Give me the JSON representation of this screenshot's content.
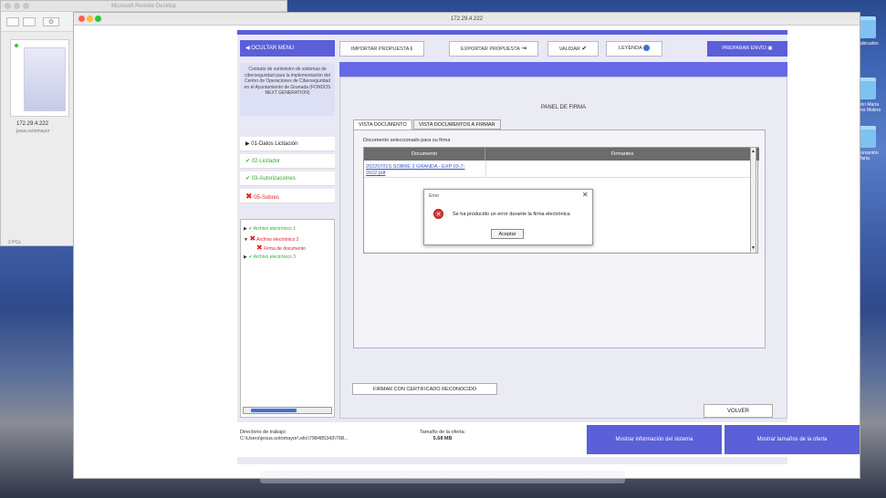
{
  "remote_desktop": {
    "title": "Microsoft Remote Desktop",
    "thumbnail_title": "172.29.4.222",
    "thumbnail_subtitle": "jesus.sotomayor",
    "pcs_count": "2 PCs"
  },
  "desktop_icons": [
    {
      "label": "ms reubicados"
    },
    {
      "label": "omunión María otomayor Molero"
    },
    {
      "label": "ium Comunión María"
    }
  ],
  "window": {
    "title": "172.29.4.222"
  },
  "side_menu": {
    "hide_label": "OCULTAR MENU",
    "contract_text": "Contrato de suministro de sistemas de ciberseguridad para la implementación del Centro de Operaciones de Ciberseguridad en el Ayuntamiento de Granada (FONDOS NEXT GENERATION)",
    "items": [
      {
        "label": "01-Datos Licitación",
        "status": "arrow",
        "color": "#222222"
      },
      {
        "label": "02-Licitador",
        "status": "check",
        "color": "#3aa83a"
      },
      {
        "label": "03-Autorizaciones",
        "status": "check",
        "color": "#3aa83a"
      },
      {
        "label": "05-Sobres",
        "status": "cross",
        "color": "#e02020"
      }
    ],
    "tree": [
      {
        "label": "Archivo electrónico 1",
        "status": "check",
        "color": "#3aa83a",
        "indent": 0
      },
      {
        "label": "Archivo electrónico 2",
        "status": "cross",
        "color": "#e02020",
        "indent": 0
      },
      {
        "label": "Firma de documento",
        "status": "cross",
        "color": "#e02020",
        "indent": 1
      },
      {
        "label": "Archivo electrónico 3",
        "status": "check",
        "color": "#3aa83a",
        "indent": 0
      }
    ]
  },
  "toolbar": {
    "import_label": "IMPORTAR PROPUESTA",
    "export_label": "EXPORTAR PROPUESTA",
    "validate_label": "VALIDAR",
    "legend_label": "LEYENDA",
    "prepare_label": "PREPARAR ENVÍO"
  },
  "panel": {
    "title": "PANEL DE FIRMA",
    "tabs": [
      {
        "label": "VISTA DOCUMENTO",
        "active": true
      },
      {
        "label": "VISTA DOCUMENTOS A FIRMAR",
        "active": false
      }
    ],
    "doc_label": "Documento seleccionado para su firma",
    "columns": [
      "Documento",
      "Firmantes"
    ],
    "rows": [
      {
        "document": "20220701S SOBRE 2 GRANDA - EXP 03-7-2022.pdf",
        "signers": ""
      }
    ],
    "sign_button": "FIRMAR CON CERTIFICADO RECONOCIDO",
    "back_button": "VOLVER"
  },
  "dialog": {
    "title": "Error",
    "close_symbol": "✕",
    "message": "Se ha producido un error durante la firma electrónica",
    "ok_label": "Aceptar"
  },
  "footer": {
    "dir_label": "Directorio de trabajo:",
    "dir_value": "C:\\Users\\jesus.sotomayor\\.elic\\798485343\\798...",
    "size_label": "Tamaño de la oferta:",
    "size_value": "5.68 MB",
    "sysinfo_button": "Mostrar información del sistema",
    "sizes_button": "Mostrar tamaños de la oferta"
  },
  "colors": {
    "accent": "#5b5fd8",
    "ok": "#3aa83a",
    "error": "#e02020"
  }
}
